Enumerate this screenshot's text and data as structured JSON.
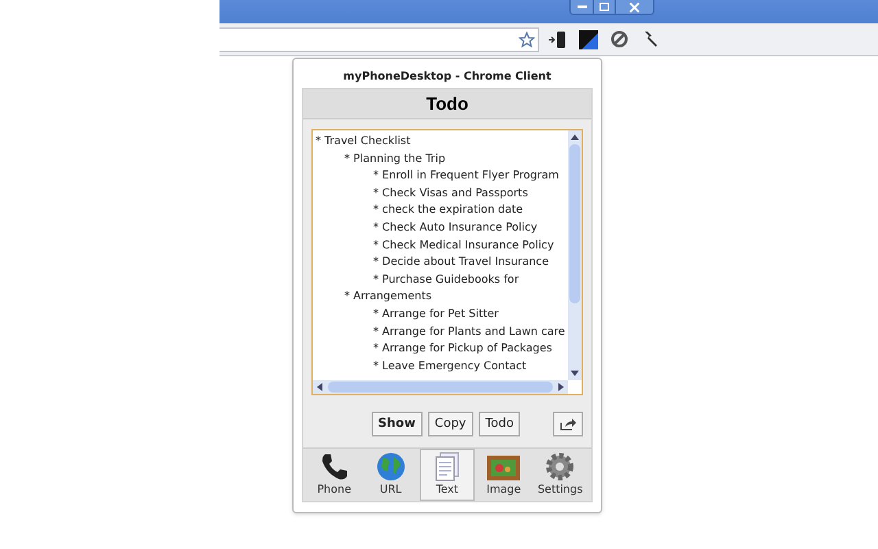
{
  "popup": {
    "title": "myPhoneDesktop - Chrome Client",
    "heading": "Todo"
  },
  "note": {
    "items": [
      {
        "text": "* Travel Checklist",
        "children": [
          {
            "text": "* Planning the Trip",
            "children": [
              {
                "text": "* Enroll in Frequent Flyer Program"
              },
              {
                "text": "* Check Visas and Passports"
              },
              {
                "text": "* check the expiration date"
              },
              {
                "text": "* Check Auto Insurance Policy"
              },
              {
                "text": "* Check Medical Insurance Policy"
              },
              {
                "text": "* Decide about Travel Insurance"
              },
              {
                "text": "* Purchase Guidebooks for"
              }
            ]
          },
          {
            "text": "* Arrangements",
            "children": [
              {
                "text": "* Arrange for Pet Sitter"
              },
              {
                "text": "* Arrange for Plants and Lawn care"
              },
              {
                "text": "* Arrange for Pickup of Packages"
              },
              {
                "text": "* Leave Emergency Contact"
              }
            ]
          }
        ]
      }
    ]
  },
  "buttons": [
    {
      "label": "Show",
      "kind": "primary"
    },
    {
      "label": "Copy",
      "kind": "plain"
    },
    {
      "label": "Todo",
      "kind": "plain"
    }
  ],
  "tabs": [
    {
      "label": "Phone",
      "kind": "phone",
      "selected": false
    },
    {
      "label": "URL",
      "kind": "globe",
      "selected": false
    },
    {
      "label": "Text",
      "kind": "document",
      "selected": true
    },
    {
      "label": "Image",
      "kind": "picture",
      "selected": false
    },
    {
      "label": "Settings",
      "kind": "gear",
      "selected": false
    }
  ]
}
